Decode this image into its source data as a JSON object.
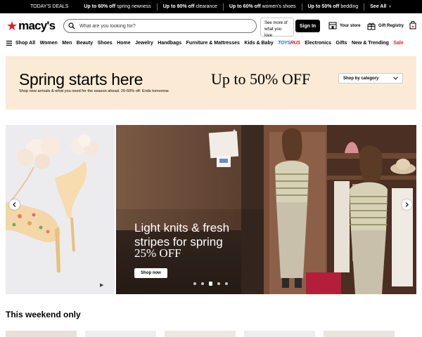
{
  "promo_bar": {
    "todays_deals": "TODAY'S DEALS",
    "deals": [
      {
        "bold": "Up to 60% off",
        "rest": "spring newness"
      },
      {
        "bold": "Up to 80% off",
        "rest": "clearance"
      },
      {
        "bold": "Up to 60% off",
        "rest": "women's shoes"
      },
      {
        "bold": "Up to 50% off",
        "rest": "bedding"
      }
    ],
    "see_all": "See All",
    "see_all_chevron": "›"
  },
  "header": {
    "logo_text": "macy's",
    "logo_color": "#e21a2c",
    "search_placeholder": "What are you looking for?",
    "see_more_line1": "See more of",
    "see_more_line2": "what you love",
    "sign_in": "Sign In",
    "your_store": "Your store",
    "gift_registry": "Gift Registry"
  },
  "nav": {
    "shop_all": "Shop All",
    "items": [
      "Women",
      "Men",
      "Beauty",
      "Shoes",
      "Home",
      "Jewelry",
      "Handbags",
      "Furniture & Mattresses",
      "Kids & Baby"
    ],
    "toys_a": "TOYS",
    "toys_b": "RUS",
    "items_after": [
      "Electronics",
      "Gifts",
      "New & Trending"
    ],
    "sale": "Sale"
  },
  "banner": {
    "title": "Spring starts here",
    "subtitle": "Shop new arrivals & what you need for the season ahead. 20-50% off. Ends tomorrow.",
    "offer": "Up to 50% OFF",
    "dropdown": "Shop by category",
    "bg_color": "#fbebd6"
  },
  "carousel": {
    "headline_line1": "Light knits & fresh",
    "headline_line2": "stripes for spring",
    "headline_offer": "25% OFF",
    "cta": "Shop now",
    "slide_count": 5,
    "active_slide": 3
  },
  "weekend": {
    "title": "This weekend only"
  }
}
